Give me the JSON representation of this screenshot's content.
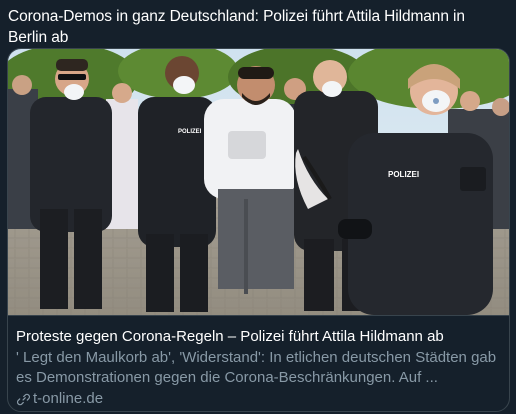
{
  "tweet": {
    "text": "Corona-Demos in ganz Deutschland: Polizei führt Attila Hildmann in Berlin ab"
  },
  "card": {
    "title": "Proteste gegen Corona-Regeln – Polizei führt Attila Hildmann ab",
    "description": "' Legt den Maulkorb ab', 'Widerstand': In etlichen deutschen Städten gab es Demonstrationen gegen die Corona-Beschränkungen. Auf ...",
    "domain": "t-online.de",
    "image": {
      "vest_label_left": "POLIZEI",
      "vest_label_right": "POLIZEI"
    }
  },
  "colors": {
    "background": "#15202b",
    "text_primary": "#ffffff",
    "text_secondary": "#8899a6",
    "border": "#38444d"
  },
  "icons": {
    "link": "link-icon"
  }
}
